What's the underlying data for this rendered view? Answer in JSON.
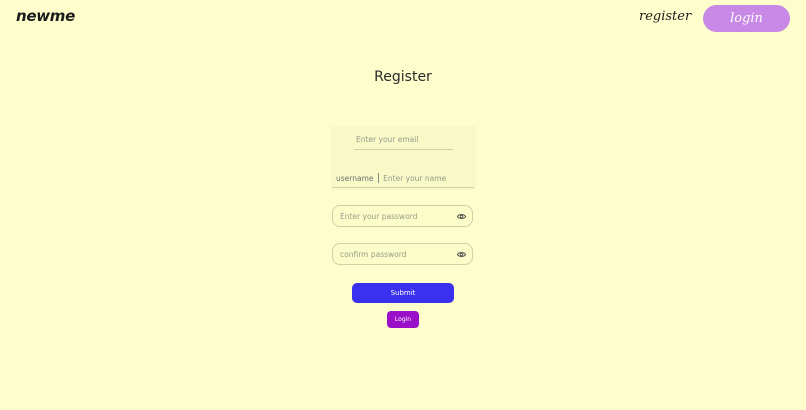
{
  "header": {
    "logo": "newme",
    "register_link": "register",
    "login_button": "login"
  },
  "form": {
    "title": "Register",
    "email_placeholder": "Enter your email",
    "username_prefix": "username",
    "name_placeholder": "Enter your name",
    "password_placeholder": "Enter your password",
    "confirm_password_placeholder": "confirm password",
    "submit_label": "Submit",
    "login_label": "Login"
  },
  "icons": {
    "password_toggle": "eye-icon"
  },
  "colors": {
    "background": "#fdfecb",
    "nav_login": "#c888e6",
    "submit": "#3a30ef",
    "login": "#9a10c9"
  }
}
